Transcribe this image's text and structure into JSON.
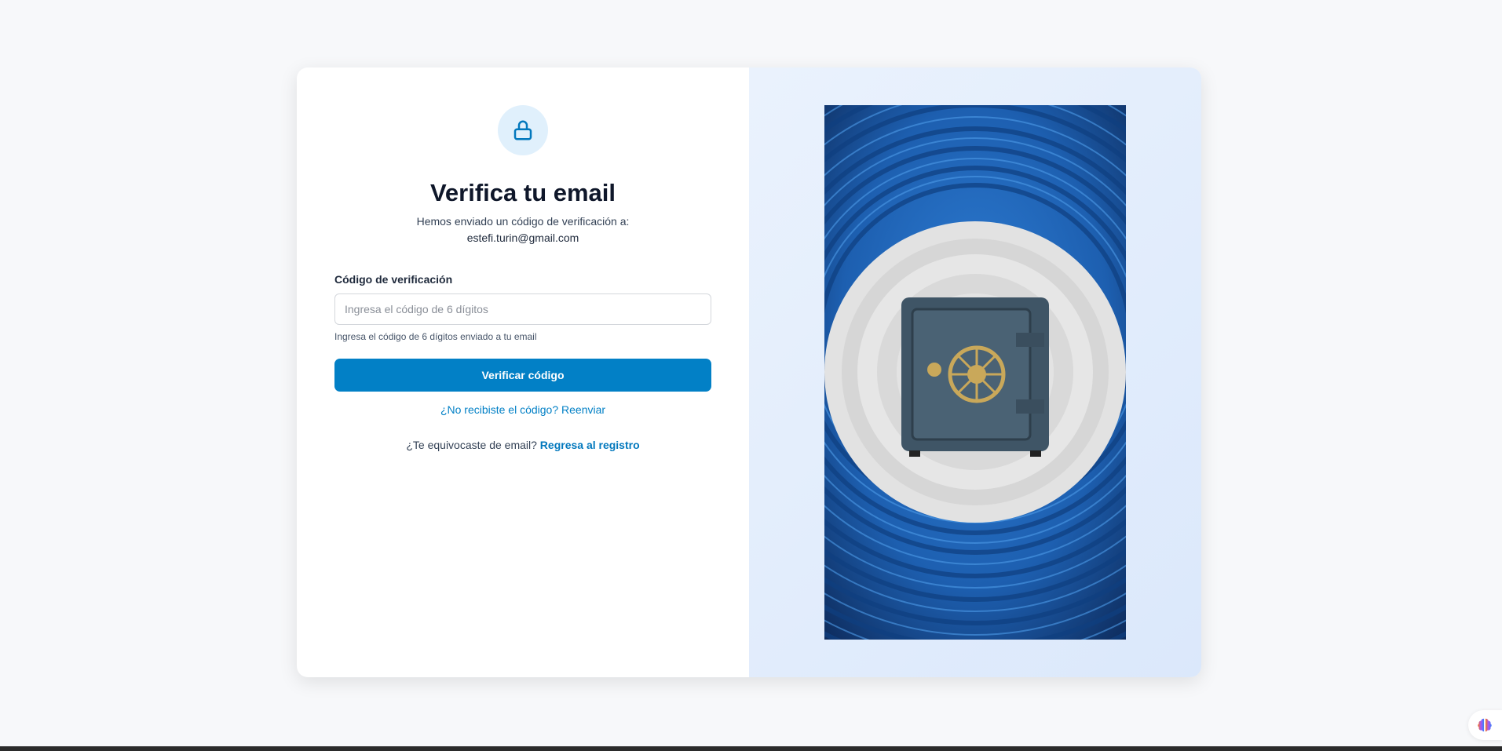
{
  "verify": {
    "title": "Verifica tu email",
    "subtitle": "Hemos enviado un código de verificación a:",
    "email": "estefi.turin@gmail.com",
    "code_label": "Código de verificación",
    "code_placeholder": "Ingresa el código de 6 dígitos",
    "code_value": "",
    "code_hint": "Ingresa el código de 6 dígitos enviado a tu email",
    "submit_label": "Verificar código",
    "resend_link": "¿No recibiste el código? Reenviar",
    "wrong_email_text": "¿Te equivocaste de email?",
    "back_link": "Regresa al registro"
  },
  "icons": {
    "header": "lock-icon",
    "floating": "brain-icon"
  },
  "colors": {
    "accent": "#0280c6",
    "lock_bg": "#e0f0fc",
    "panel_bg": "#e3eefc"
  }
}
